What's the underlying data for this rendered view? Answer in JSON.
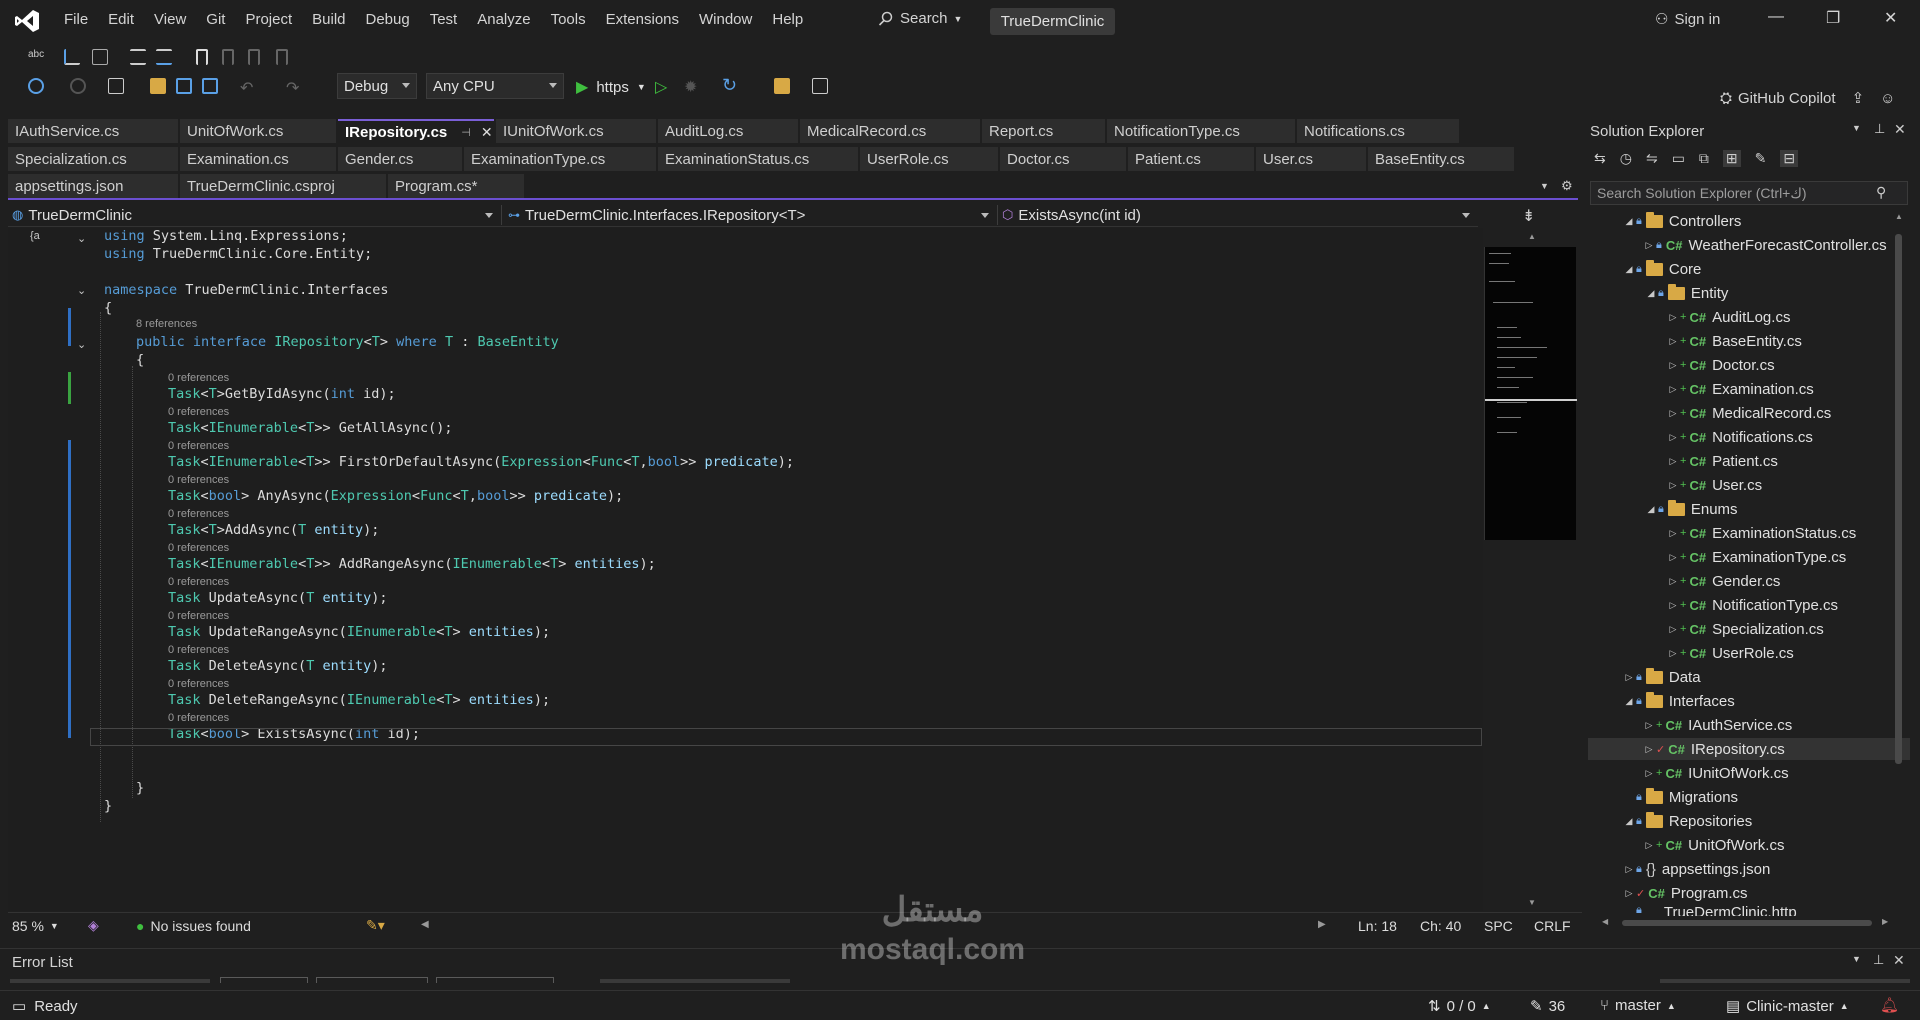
{
  "titlebar": {
    "menu": [
      "File",
      "Edit",
      "View",
      "Git",
      "Project",
      "Build",
      "Debug",
      "Test",
      "Analyze",
      "Tools",
      "Extensions",
      "Window",
      "Help"
    ],
    "search_label": "Search",
    "solution_name": "TrueDermClinic",
    "sign_in": "Sign in"
  },
  "toolbar": {
    "configuration": "Debug",
    "platform": "Any CPU",
    "run_profile": "https",
    "copilot": "GitHub Copilot"
  },
  "tabs": {
    "row1": [
      {
        "label": "IAuthService.cs"
      },
      {
        "label": "UnitOfWork.cs"
      },
      {
        "label": "IRepository.cs",
        "active": true
      },
      {
        "label": "IUnitOfWork.cs"
      },
      {
        "label": "AuditLog.cs"
      },
      {
        "label": "MedicalRecord.cs"
      },
      {
        "label": "Report.cs"
      },
      {
        "label": "NotificationType.cs"
      },
      {
        "label": "Notifications.cs"
      }
    ],
    "row2": [
      {
        "label": "Specialization.cs"
      },
      {
        "label": "Examination.cs"
      },
      {
        "label": "Gender.cs"
      },
      {
        "label": "ExaminationType.cs"
      },
      {
        "label": "ExaminationStatus.cs"
      },
      {
        "label": "UserRole.cs"
      },
      {
        "label": "Doctor.cs"
      },
      {
        "label": "Patient.cs"
      },
      {
        "label": "User.cs"
      },
      {
        "label": "BaseEntity.cs"
      }
    ],
    "row3": [
      {
        "label": "appsettings.json"
      },
      {
        "label": "TrueDermClinic.csproj"
      },
      {
        "label": "Program.cs*"
      }
    ]
  },
  "navbar": {
    "project": "TrueDermClinic",
    "type": "TrueDermClinic.Interfaces.IRepository<T>",
    "member": "ExistsAsync(int id)"
  },
  "code": {
    "using1": "System.Linq.Expressions;",
    "using2": "TrueDermClinic.Core.Entity;",
    "namespace": "TrueDermClinic.Interfaces",
    "refs_interface": "8 references",
    "refs_member": "0 references"
  },
  "editor_status": {
    "zoom": "85 %",
    "issues": "No issues found",
    "line": "Ln: 18",
    "col": "Ch: 40",
    "spacing": "SPC",
    "eol": "CRLF"
  },
  "solution_explorer": {
    "title": "Solution Explorer",
    "search_placeholder": "Search Solution Explorer (Ctrl+ك)",
    "items": [
      {
        "label": "Controllers"
      },
      {
        "label": "WeatherForecastController.cs"
      },
      {
        "label": "Core"
      },
      {
        "label": "Entity"
      },
      {
        "label": "AuditLog.cs"
      },
      {
        "label": "BaseEntity.cs"
      },
      {
        "label": "Doctor.cs"
      },
      {
        "label": "Examination.cs"
      },
      {
        "label": "MedicalRecord.cs"
      },
      {
        "label": "Notifications.cs"
      },
      {
        "label": "Patient.cs"
      },
      {
        "label": "User.cs"
      },
      {
        "label": "Enums"
      },
      {
        "label": "ExaminationStatus.cs"
      },
      {
        "label": "ExaminationType.cs"
      },
      {
        "label": "Gender.cs"
      },
      {
        "label": "NotificationType.cs"
      },
      {
        "label": "Specialization.cs"
      },
      {
        "label": "UserRole.cs"
      },
      {
        "label": "Data"
      },
      {
        "label": "Interfaces"
      },
      {
        "label": "IAuthService.cs"
      },
      {
        "label": "IRepository.cs"
      },
      {
        "label": "IUnitOfWork.cs"
      },
      {
        "label": "Migrations"
      },
      {
        "label": "Repositories"
      },
      {
        "label": "UnitOfWork.cs"
      },
      {
        "label": "appsettings.json"
      },
      {
        "label": "Program.cs"
      },
      {
        "label": "TrueDermClinic.http"
      }
    ]
  },
  "error_list": {
    "title": "Error List"
  },
  "statusbar": {
    "ready": "Ready",
    "sync": "0 / 0",
    "changes": "36",
    "branch": "master",
    "repo": "Clinic-master"
  },
  "watermark": {
    "arabic": "مستقل",
    "latin": "mostaql.com"
  }
}
